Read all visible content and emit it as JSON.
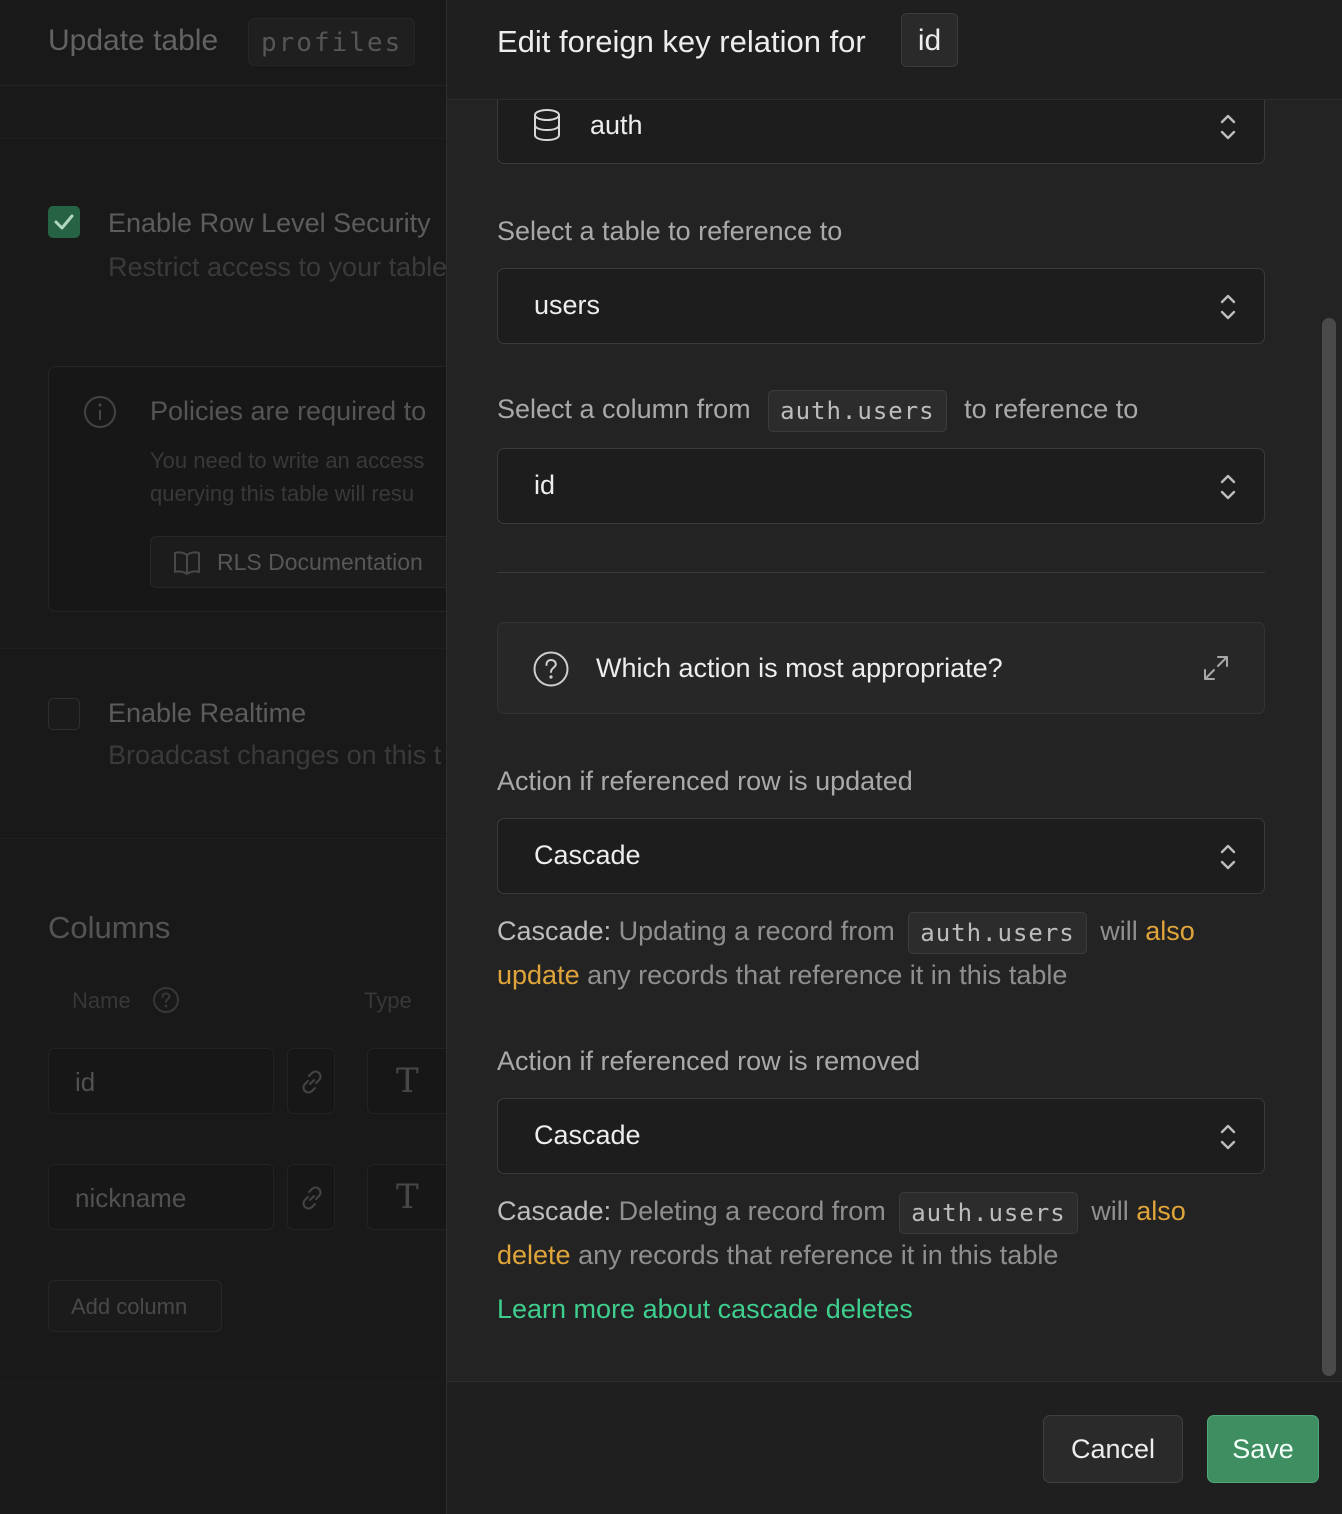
{
  "background": {
    "title": "Update table",
    "table_name": "profiles",
    "rls": {
      "checked": true,
      "label": "Enable Row Level Security",
      "description": "Restrict access to your table"
    },
    "policy_notice": {
      "title": "Policies are required to",
      "line1": "You need to write an access",
      "line2": "querying this table will resu",
      "doc_button": "RLS Documentation"
    },
    "realtime": {
      "checked": false,
      "label": "Enable Realtime",
      "description": "Broadcast changes on this t"
    },
    "columns": {
      "title": "Columns",
      "name_header": "Name",
      "type_header": "Type",
      "rows": [
        {
          "name": "id",
          "type_glyph": "T"
        },
        {
          "name": "nickname",
          "type_glyph": "T"
        }
      ],
      "add_button": "Add column"
    }
  },
  "panel": {
    "title_prefix": "Edit foreign key relation for",
    "column_chip": "id",
    "schema_select": {
      "value": "auth",
      "icon": "database-icon"
    },
    "table_label": "Select a table to reference to",
    "table_select": {
      "value": "users"
    },
    "column_label": {
      "before": "Select a column from",
      "code": "auth.users",
      "after": "to reference to"
    },
    "column_select": {
      "value": "id"
    },
    "help_box": {
      "text": "Which action is most appropriate?"
    },
    "update_action": {
      "label": "Action if referenced row is updated",
      "value": "Cascade",
      "desc_prefix": "Cascade:",
      "desc_text1": "Updating a record from",
      "desc_code": "auth.users",
      "desc_will": "will",
      "desc_hl": "also update",
      "desc_rest": "any records that reference it in this table"
    },
    "delete_action": {
      "label": "Action if referenced row is removed",
      "value": "Cascade",
      "desc_prefix": "Cascade:",
      "desc_text1": "Deleting a record from",
      "desc_code": "auth.users",
      "desc_will": "will",
      "desc_hl": "also delete",
      "desc_rest": "any records that reference it in this table"
    },
    "learn_more": "Learn more about cascade deletes",
    "cancel_label": "Cancel",
    "save_label": "Save"
  },
  "colors": {
    "accent_green": "#3ecf8e",
    "save_button": "#3e8e62",
    "highlight_amber": "#e0a53a",
    "panel_bg": "#232323",
    "page_bg": "#1c1c1c"
  }
}
